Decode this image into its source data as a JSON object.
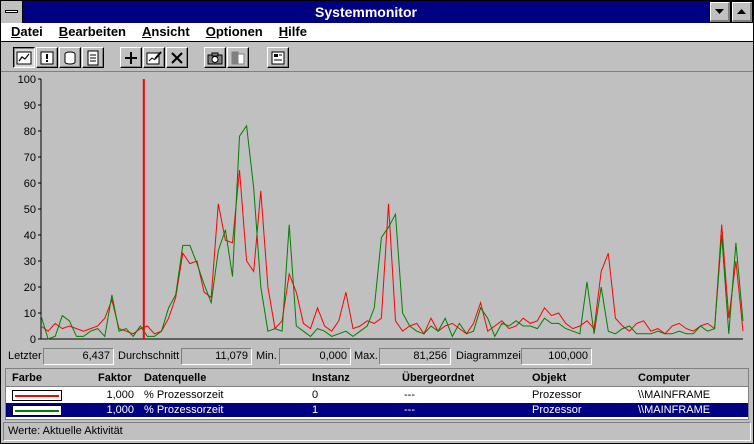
{
  "window": {
    "title": "Systemmonitor"
  },
  "menu": {
    "items": [
      {
        "label": "Datei",
        "accel": "D",
        "rest": "atei"
      },
      {
        "label": "Bearbeiten",
        "accel": "B",
        "rest": "earbeiten"
      },
      {
        "label": "Ansicht",
        "accel": "A",
        "rest": "nsicht"
      },
      {
        "label": "Optionen",
        "accel": "O",
        "rest": "ptionen"
      },
      {
        "label": "Hilfe",
        "accel": "H",
        "rest": "ilfe"
      }
    ]
  },
  "toolbar": {
    "buttons": [
      {
        "name": "chart-view-button",
        "icon": "chart-icon",
        "pressed": true
      },
      {
        "name": "alert-view-button",
        "icon": "alert-icon",
        "pressed": false
      },
      {
        "name": "log-view-button",
        "icon": "log-icon",
        "pressed": false
      },
      {
        "name": "report-view-button",
        "icon": "report-icon",
        "pressed": false
      },
      {
        "name": "add-counter-button",
        "icon": "plus-icon",
        "pressed": false
      },
      {
        "name": "edit-counter-button",
        "icon": "edit-icon",
        "pressed": false
      },
      {
        "name": "delete-counter-button",
        "icon": "delete-icon",
        "pressed": false
      },
      {
        "name": "snapshot-button",
        "icon": "camera-icon",
        "pressed": false
      },
      {
        "name": "bookmark-button",
        "icon": "bookmark-icon",
        "pressed": false
      },
      {
        "name": "options-button",
        "icon": "options-icon",
        "pressed": false
      }
    ]
  },
  "stats": {
    "last_label": "Letzter",
    "last_value": "6,437",
    "avg_label": "Durchschnitt",
    "avg_value": "11,079",
    "min_label": "Min.",
    "min_value": "0,000",
    "max_label": "Max.",
    "max_value": "81,256",
    "time_label": "Diagrammzeit",
    "time_value": "100,000"
  },
  "legend": {
    "headers": {
      "color": "Farbe",
      "scale": "Faktor",
      "counter": "Datenquelle",
      "instance": "Instanz",
      "parent": "Übergeordnet",
      "object": "Objekt",
      "computer": "Computer"
    },
    "rows": [
      {
        "color": "#ff0000",
        "scale": "1,000",
        "counter": "% Prozessorzeit",
        "instance": "0",
        "parent": "---",
        "object": "Prozessor",
        "computer": "\\\\MAINFRAME",
        "selected": false
      },
      {
        "color": "#008000",
        "scale": "1,000",
        "counter": "% Prozessorzeit",
        "instance": "1",
        "parent": "---",
        "object": "Prozessor",
        "computer": "\\\\MAINFRAME",
        "selected": true
      }
    ]
  },
  "status": {
    "text": "Werte: Aktuelle Aktivität"
  },
  "colors": {
    "titlebar": "#000080",
    "chart_bg": "#c0c0c0",
    "cursor": "#ff0000",
    "selection": "#000080"
  },
  "chart_data": {
    "type": "line",
    "ylim": [
      0,
      100
    ],
    "yticks": [
      "0",
      "10",
      "20",
      "30",
      "40",
      "50",
      "60",
      "70",
      "80",
      "90",
      "100"
    ],
    "grid": false,
    "cursor_x": 14.5,
    "x": [
      0,
      1,
      2,
      3,
      4,
      5,
      6,
      7,
      8,
      9,
      10,
      11,
      12,
      13,
      14,
      15,
      16,
      17,
      18,
      19,
      20,
      21,
      22,
      23,
      24,
      25,
      26,
      27,
      28,
      29,
      30,
      31,
      32,
      33,
      34,
      35,
      36,
      37,
      38,
      39,
      40,
      41,
      42,
      43,
      44,
      45,
      46,
      47,
      48,
      49,
      50,
      51,
      52,
      53,
      54,
      55,
      56,
      57,
      58,
      59,
      60,
      61,
      62,
      63,
      64,
      65,
      66,
      67,
      68,
      69,
      70,
      71,
      72,
      73,
      74,
      75,
      76,
      77,
      78,
      79,
      80,
      81,
      82,
      83,
      84,
      85,
      86,
      87,
      88,
      89,
      90,
      91,
      92,
      93,
      94,
      95,
      96,
      97,
      98,
      99
    ],
    "series": [
      {
        "color": "#ff0000",
        "values": [
          5,
          3,
          6,
          4,
          5,
          4,
          3,
          4,
          5,
          8,
          15,
          4,
          3,
          2,
          4,
          5,
          2,
          3,
          8,
          16,
          33,
          29,
          30,
          18,
          16,
          52,
          38,
          37,
          65,
          30,
          26,
          57,
          20,
          4,
          7,
          25,
          18,
          6,
          4,
          12,
          5,
          3,
          7,
          18,
          4,
          5,
          7,
          6,
          8,
          52,
          7,
          3,
          5,
          6,
          2,
          8,
          3,
          5,
          6,
          4,
          2,
          6,
          14,
          3,
          5,
          7,
          4,
          5,
          8,
          6,
          7,
          12,
          9,
          10,
          6,
          4,
          5,
          7,
          4,
          26,
          33,
          8,
          5,
          3,
          6,
          7,
          3,
          4,
          2,
          5,
          6,
          4,
          3,
          5,
          6,
          4,
          44,
          8,
          30,
          3
        ]
      },
      {
        "color": "#008000",
        "values": [
          9,
          0,
          1,
          9,
          7,
          1,
          1,
          3,
          4,
          1,
          17,
          3,
          4,
          1,
          5,
          1,
          1,
          3,
          12,
          17,
          36,
          36,
          29,
          21,
          14,
          34,
          42,
          24,
          78,
          82,
          58,
          20,
          3,
          4,
          3,
          44,
          5,
          3,
          1,
          4,
          3,
          1,
          2,
          3,
          1,
          3,
          5,
          12,
          39,
          43,
          48,
          10,
          5,
          3,
          2,
          5,
          3,
          8,
          1,
          6,
          2,
          3,
          12,
          8,
          1,
          6,
          5,
          7,
          5,
          5,
          4,
          8,
          6,
          6,
          4,
          3,
          2,
          22,
          2,
          20,
          3,
          2,
          4,
          5,
          2,
          2,
          2,
          3,
          2,
          2,
          3,
          2,
          2,
          5,
          3,
          4,
          40,
          2,
          37,
          7
        ]
      }
    ]
  }
}
